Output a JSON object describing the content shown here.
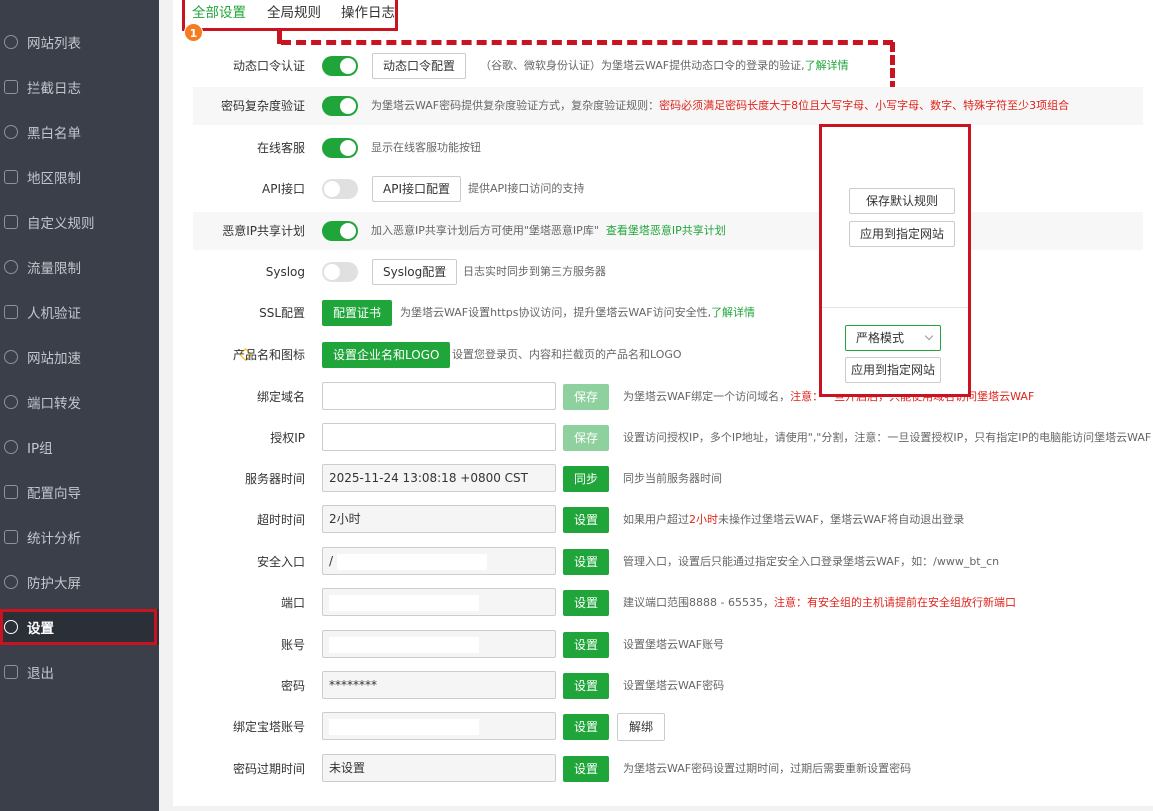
{
  "sidebar": {
    "items": [
      {
        "label": "网站列表",
        "icon": "globe-icon"
      },
      {
        "label": "拦截日志",
        "icon": "log-icon"
      },
      {
        "label": "黑白名单",
        "icon": "user-icon"
      },
      {
        "label": "地区限制",
        "icon": "map-icon"
      },
      {
        "label": "自定义规则",
        "icon": "edit-icon"
      },
      {
        "label": "流量限制",
        "icon": "wave-icon"
      },
      {
        "label": "人机验证",
        "icon": "robot-icon"
      },
      {
        "label": "网站加速",
        "icon": "bolt-icon"
      },
      {
        "label": "端口转发",
        "icon": "refresh-icon"
      },
      {
        "label": "IP组",
        "icon": "shield-icon"
      },
      {
        "label": "配置向导",
        "icon": "flow-icon"
      },
      {
        "label": "统计分析",
        "icon": "chart-icon"
      },
      {
        "label": "防护大屏",
        "icon": "screen-shield-icon"
      },
      {
        "label": "设置",
        "icon": "gear-icon"
      },
      {
        "label": "退出",
        "icon": "logout-icon"
      }
    ]
  },
  "tabs": [
    "全部设置",
    "全局规则",
    "操作日志"
  ],
  "step_badge": "1",
  "rows": {
    "totp": {
      "label": "动态口令认证",
      "button": "动态口令配置",
      "desc": "（谷歌、微软身份认证）为堡塔云WAF提供动态口令的登录的验证,",
      "link": "了解详情"
    },
    "pwd_complex": {
      "label": "密码复杂度验证",
      "desc": "为堡塔云WAF密码提供复杂度验证方式，复杂度验证规则：",
      "desc_red": "密码必须满足密码长度大于8位且大写字母、小写字母、数字、特殊字符至少3项组合"
    },
    "support": {
      "label": "在线客服",
      "desc": "显示在线客服功能按钮"
    },
    "api": {
      "label": "API接口",
      "button": "API接口配置",
      "desc": "提供API接口访问的支持"
    },
    "malicious_ip": {
      "label": "恶意IP共享计划",
      "desc": "加入恶意IP共享计划后方可使用\"堡塔恶意IP库\"",
      "link": "查看堡塔恶意IP共享计划"
    },
    "syslog": {
      "label": "Syslog",
      "button": "Syslog配置",
      "desc": "日志实时同步到第三方服务器"
    },
    "ssl": {
      "label": "SSL配置",
      "button": "配置证书",
      "desc": "为堡塔云WAF设置https协议访问，提升堡塔云WAF访问安全性,",
      "link": "了解详情"
    },
    "brand": {
      "label": "产品名和图标",
      "button": "设置企业名和LOGO",
      "desc": "设置您登录页、内容和拦截页的产品名和LOGO"
    },
    "domain": {
      "label": "绑定域名",
      "value": "",
      "button": "保存",
      "desc": "为堡塔云WAF绑定一个访问域名，",
      "desc_red": "注意：一旦开启后，只能使用域名访问堡塔云WAF"
    },
    "auth_ip": {
      "label": "授权IP",
      "value": "",
      "button": "保存",
      "desc": "设置访问授权IP，多个IP地址，请使用\",\"分割，注意：一旦设置授权IP，只有指定IP的电脑能访问堡塔云WAF"
    },
    "server_time": {
      "label": "服务器时间",
      "value": "2025-11-24 13:08:18 +0800 CST",
      "button": "同步",
      "desc": "同步当前服务器时间"
    },
    "timeout": {
      "label": "超时时间",
      "value": "2小时",
      "button": "设置",
      "desc_pre": "如果用户超过",
      "desc_red": "2小时",
      "desc_post": "未操作过堡塔云WAF，堡塔云WAF将自动退出登录"
    },
    "entry": {
      "label": "安全入口",
      "value": "/",
      "button": "设置",
      "desc": "管理入口，设置后只能通过指定安全入口登录堡塔云WAF，如：/www_bt_cn"
    },
    "port": {
      "label": "端口",
      "value": "",
      "button": "设置",
      "desc": "建议端口范围8888 - 65535，",
      "desc_red": "注意：有安全组的主机请提前在安全组放行新端口"
    },
    "account": {
      "label": "账号",
      "value": "",
      "button": "设置",
      "desc": "设置堡塔云WAF账号"
    },
    "password": {
      "label": "密码",
      "value": "********",
      "button": "设置",
      "desc": "设置堡塔云WAF密码"
    },
    "bt_account": {
      "label": "绑定宝塔账号",
      "value": "",
      "button": "设置",
      "button2": "解绑"
    },
    "pwd_expire": {
      "label": "密码过期时间",
      "value": "未设置",
      "button": "设置",
      "desc": "为堡塔云WAF密码设置过期时间，过期后需要重新设置密码"
    }
  },
  "right_panel": {
    "save_default": "保存默认规则",
    "apply_site": "应用到指定网站",
    "mode": "严格模式",
    "apply_site2": "应用到指定网站"
  },
  "colors": {
    "accent": "#20a53a",
    "highlight": "#c91320",
    "sidebar_bg": "#3a3f4a"
  }
}
